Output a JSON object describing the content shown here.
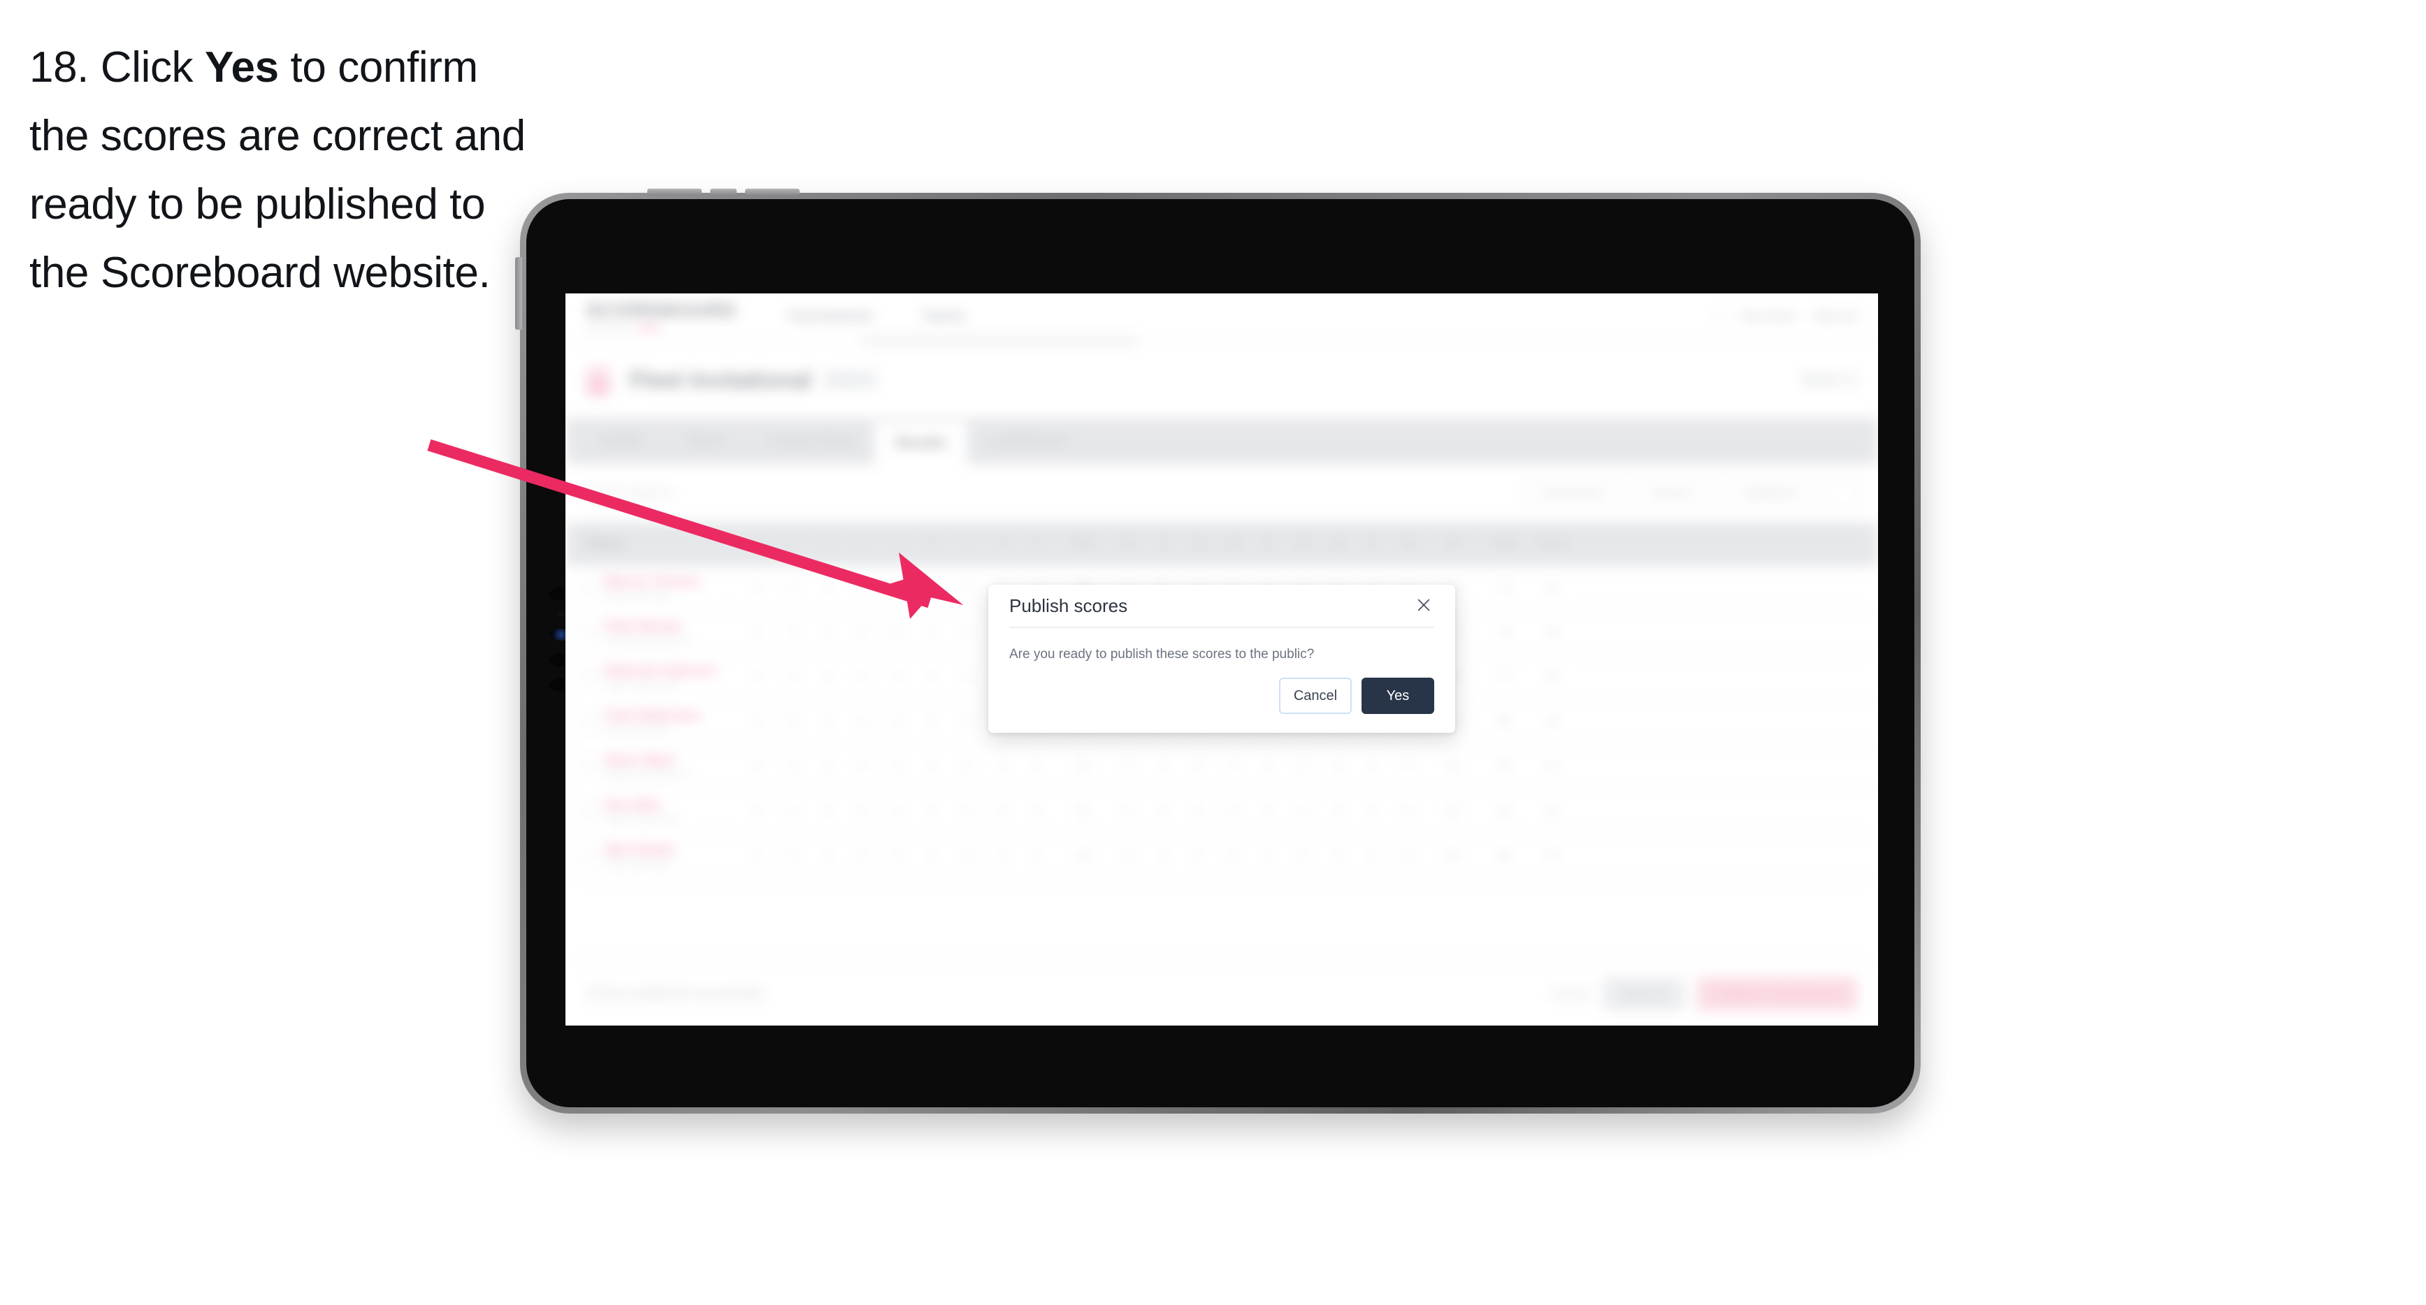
{
  "caption": {
    "step_number": "18.",
    "before_bold": " Click ",
    "bold": "Yes",
    "after_bold": " to confirm the scores are correct and ready to be published to the Scoreboard website."
  },
  "colors": {
    "arrow": "#ec2a62",
    "primary_button": "#283548",
    "brand_pink": "#f1457d",
    "device_body": "#0b0b0c"
  },
  "device": {
    "name": "tablet",
    "buttons": [
      "power-button",
      "volume-up-button",
      "volume-down-button"
    ]
  },
  "modal": {
    "title": "Publish scores",
    "message": "Are you ready to publish these scores to the public?",
    "close_icon": "close-icon",
    "cancel_label": "Cancel",
    "confirm_label": "Yes"
  },
  "app": {
    "brand": {
      "word": "SCOREBOARD",
      "sub_left": "powered by",
      "sub_accent": "NFM"
    },
    "nav": [
      "Tournaments",
      "Teams"
    ],
    "header_right": [
      "Tom Davis",
      "Sign out"
    ],
    "title": {
      "icon": "trophy-icon",
      "name": "Fleet Invitational",
      "year": "2024",
      "right": "Week 12"
    },
    "tabs": [
      {
        "label": "Details",
        "active": false
      },
      {
        "label": "Teams",
        "active": false
      },
      {
        "label": "Course Setup",
        "active": false
      },
      {
        "label": "Results",
        "active": true
      },
      {
        "label": "Leaderboard",
        "active": false
      }
    ],
    "search_placeholder": "Search players",
    "filters": [
      "All Divisions",
      "Round 1",
      "Stableford"
    ],
    "table": {
      "columns": [
        "Player",
        "1",
        "2",
        "3",
        "4",
        "5",
        "6",
        "7",
        "8",
        "9",
        "OUT",
        "10",
        "11",
        "12",
        "13",
        "14",
        "15",
        "16",
        "17",
        "18",
        "IN",
        "Total",
        "Points"
      ],
      "rows": [
        {
          "name": "Marcus Tomson",
          "club": "Fleet Golf Club",
          "scores": [
            "4",
            "3",
            "5",
            "4",
            "4",
            "3",
            "5",
            "4",
            "4",
            "36",
            "4",
            "5",
            "3",
            "4",
            "4",
            "5",
            "3",
            "4",
            "4",
            "36",
            "72",
            "34"
          ]
        },
        {
          "name": "Peter Barratt",
          "club": "Hartley Wintney GC",
          "scores": [
            "5",
            "4",
            "4",
            "3",
            "5",
            "4",
            "4",
            "5",
            "4",
            "38",
            "4",
            "4",
            "4",
            "5",
            "3",
            "4",
            "4",
            "5",
            "4",
            "37",
            "75",
            "32"
          ]
        },
        {
          "name": "Deborah Andersen",
          "club": "North Hants Golf",
          "scores": [
            "4",
            "4",
            "5",
            "5",
            "4",
            "4",
            "4",
            "4",
            "5",
            "39",
            "5",
            "4",
            "4",
            "4",
            "5",
            "4",
            "4",
            "4",
            "4",
            "38",
            "77",
            "31"
          ]
        },
        {
          "name": "Colin Bakerman",
          "club": "Fleet Golf Club",
          "scores": [
            "5",
            "5",
            "4",
            "4",
            "4",
            "5",
            "4",
            "5",
            "4",
            "40",
            "4",
            "5",
            "4",
            "5",
            "4",
            "4",
            "5",
            "4",
            "5",
            "40",
            "80",
            "29"
          ]
        },
        {
          "name": "Oliver Ward",
          "club": "Hartley Wintney GC",
          "scores": [
            "4",
            "5",
            "5",
            "4",
            "5",
            "4",
            "5",
            "4",
            "5",
            "41",
            "5",
            "4",
            "5",
            "4",
            "5",
            "5",
            "4",
            "5",
            "4",
            "41",
            "82",
            "27"
          ]
        },
        {
          "name": "Sue Allen",
          "club": "North Hants Golf",
          "scores": [
            "5",
            "5",
            "4",
            "5",
            "4",
            "5",
            "5",
            "5",
            "4",
            "42",
            "5",
            "5",
            "4",
            "5",
            "5",
            "4",
            "5",
            "4",
            "5",
            "42",
            "84",
            "25"
          ]
        },
        {
          "name": "Nick Stokes",
          "club": "Fleet Golf Club",
          "scores": [
            "5",
            "4",
            "5",
            "5",
            "5",
            "5",
            "4",
            "5",
            "5",
            "43",
            "5",
            "4",
            "5",
            "5",
            "4",
            "5",
            "5",
            "5",
            "5",
            "43",
            "86",
            "23"
          ]
        }
      ]
    },
    "bottom": {
      "note": "Scores published successfully",
      "link": "Cancel",
      "secondary_button": "Save all",
      "primary_button": "Publish to Scoreboard"
    }
  }
}
